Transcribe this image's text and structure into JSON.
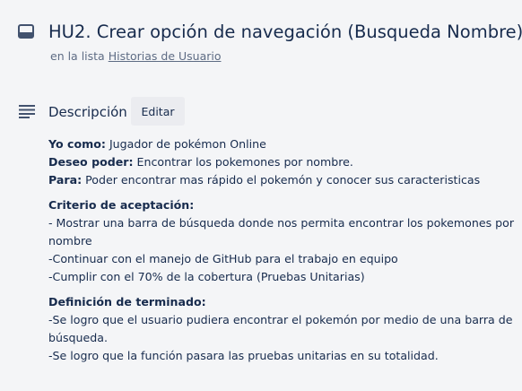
{
  "card": {
    "title": "HU2. Crear opción de navegación (Busqueda Nombre)",
    "list_prefix": "en la lista",
    "list_name": "Historias de Usuario",
    "header_icon": "card-icon"
  },
  "description": {
    "heading": "Descripción",
    "heading_icon": "description-lines-icon",
    "edit_label": "Editar",
    "yo_como_label": "Yo como:",
    "yo_como_value": " Jugador de pokémon Online",
    "deseo_label": "Deseo poder:",
    "deseo_value": " Encontrar los pokemones por nombre.",
    "para_label": "Para:",
    "para_value": " Poder encontrar mas rápido el pokemón y conocer sus caracteristicas",
    "criterio_label": "Criterio de aceptación:",
    "criterio_items": [
      "- Mostrar una barra de búsqueda donde nos permita encontrar los pokemones por nombre",
      "-Continuar con el manejo de GitHub para el trabajo en equipo",
      "-Cumplir con el 70% de la cobertura (Pruebas Unitarias)"
    ],
    "definicion_label": "Definición de terminado:",
    "definicion_items": [
      "-Se logro que el usuario pudiera encontrar el pokemón por medio de una barra de búsqueda.",
      "-Se logro que la función pasara las pruebas unitarias en su totalidad."
    ]
  },
  "colors": {
    "background": "#f4f5f7",
    "text": "#172b4d",
    "muted": "#5e6c84",
    "button_bg": "#ebecf0"
  }
}
